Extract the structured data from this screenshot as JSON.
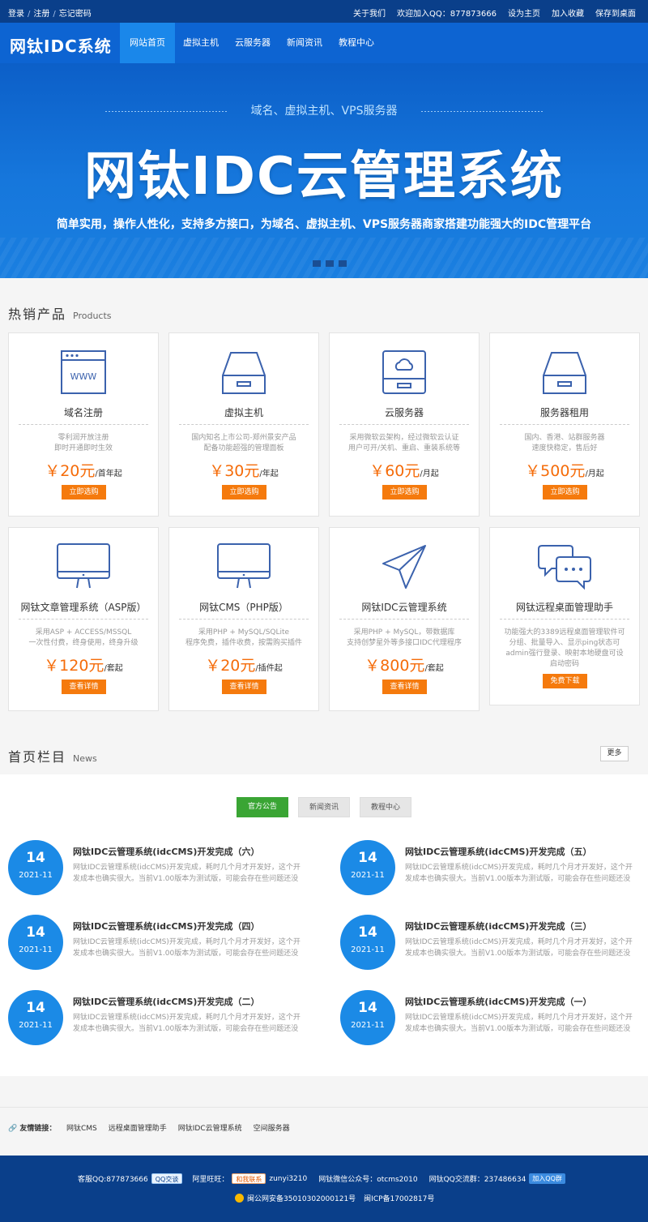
{
  "topbar": {
    "left_links": [
      "登录",
      "注册",
      "忘记密码"
    ],
    "right_links": [
      "关于我们",
      "欢迎加入QQ：877873666",
      "设为主页",
      "加入收藏",
      "保存到桌面"
    ]
  },
  "nav": {
    "logo": "网钛IDC系统",
    "items": [
      "网站首页",
      "虚拟主机",
      "云服务器",
      "新闻资讯",
      "教程中心"
    ]
  },
  "banner": {
    "subtitle": "域名、虚拟主机、VPS服务器",
    "title": "网钛IDC云管理系统",
    "desc": "简单实用，操作人性化，支持多方接口，为域名、虚拟主机、VPS服务器商家搭建功能强大的IDC管理平台"
  },
  "products": {
    "title": "热销产品",
    "title_en": "Products",
    "items": [
      {
        "name": "域名注册",
        "d1": "零利润开放注册",
        "d2": "即时开通即时生效",
        "price": "￥20元",
        "unit": "/首年起",
        "btn": "立即选购",
        "icon": "browser-www-icon"
      },
      {
        "name": "虚拟主机",
        "d1": "国内知名上市公司-郑州景安产品",
        "d2": "配备功能超强的管理面板",
        "price": "￥30元",
        "unit": "/年起",
        "btn": "立即选购",
        "icon": "drive-icon"
      },
      {
        "name": "云服务器",
        "d1": "采用微软云架构，经过微软云认证",
        "d2": "用户可开/关机、重启、重装系统等",
        "price": "￥60元",
        "unit": "/月起",
        "btn": "立即选购",
        "icon": "cloud-server-icon"
      },
      {
        "name": "服务器租用",
        "d1": "国内、香港、站群服务器",
        "d2": "速度快稳定，售后好",
        "price": "￥500元",
        "unit": "/月起",
        "btn": "立即选购",
        "icon": "server-icon"
      },
      {
        "name": "网钛文章管理系统（ASP版）",
        "d1": "采用ASP + ACCESS/MSSQL",
        "d2": "一次性付费，终身使用，终身升级",
        "price": "￥120元",
        "unit": "/套起",
        "btn": "查看详情",
        "icon": "monitor-icon"
      },
      {
        "name": "网钛CMS（PHP版）",
        "d1": "采用PHP + MySQL/SQLite",
        "d2": "程序免费，插件收费，按需购买插件",
        "price": "￥20元",
        "unit": "/插件起",
        "btn": "查看详情",
        "icon": "monitor-icon"
      },
      {
        "name": "网钛IDC云管理系统",
        "d1": "采用PHP + MySQL，带数据库",
        "d2": "支持创梦星外等多接口IDC代理程序",
        "price": "￥800元",
        "unit": "/套起",
        "btn": "查看详情",
        "icon": "paper-plane-icon"
      },
      {
        "name": "网钛远程桌面管理助手",
        "d1": "功能强大的3389远程桌面管理软件可",
        "d2": "分组、批量导入、显示ping状态可",
        "d3": "admin强行登录、映射本地硬盘可设",
        "d4": "启动密码",
        "btn": "免费下载",
        "icon": "chat-icon"
      }
    ]
  },
  "news": {
    "title": "首页栏目",
    "title_en": "News",
    "more": "更多",
    "tabs": [
      "官方公告",
      "新闻资讯",
      "教程中心"
    ],
    "items": [
      {
        "day": "14",
        "ym": "2021-11",
        "title": "网钛IDC云管理系统(idcCMS)开发完成（六）",
        "d1": "网钛IDC云管理系统(idcCMS)开发完成，耗时几个月才开发好，这个开",
        "d2": "发成本也确实很大。当前V1.00版本为测试版，可能会存在些问题还没"
      },
      {
        "day": "14",
        "ym": "2021-11",
        "title": "网钛IDC云管理系统(idcCMS)开发完成（五）",
        "d1": "网钛IDC云管理系统(idcCMS)开发完成，耗时几个月才开发好，这个开",
        "d2": "发成本也确实很大。当前V1.00版本为测试版，可能会存在些问题还没"
      },
      {
        "day": "14",
        "ym": "2021-11",
        "title": "网钛IDC云管理系统(idcCMS)开发完成（四）",
        "d1": "网钛IDC云管理系统(idcCMS)开发完成，耗时几个月才开发好，这个开",
        "d2": "发成本也确实很大。当前V1.00版本为测试版，可能会存在些问题还没"
      },
      {
        "day": "14",
        "ym": "2021-11",
        "title": "网钛IDC云管理系统(idcCMS)开发完成（三）",
        "d1": "网钛IDC云管理系统(idcCMS)开发完成，耗时几个月才开发好，这个开",
        "d2": "发成本也确实很大。当前V1.00版本为测试版，可能会存在些问题还没"
      },
      {
        "day": "14",
        "ym": "2021-11",
        "title": "网钛IDC云管理系统(idcCMS)开发完成（二）",
        "d1": "网钛IDC云管理系统(idcCMS)开发完成，耗时几个月才开发好，这个开",
        "d2": "发成本也确实很大。当前V1.00版本为测试版，可能会存在些问题还没"
      },
      {
        "day": "14",
        "ym": "2021-11",
        "title": "网钛IDC云管理系统(idcCMS)开发完成（一）",
        "d1": "网钛IDC云管理系统(idcCMS)开发完成，耗时几个月才开发好，这个开",
        "d2": "发成本也确实很大。当前V1.00版本为测试版，可能会存在些问题还没"
      }
    ]
  },
  "links": {
    "label": "友情链接：",
    "items": [
      "网钛CMS",
      "远程桌面管理助手",
      "网钛IDC云管理系统",
      "空间服务器"
    ]
  },
  "footer": {
    "kefu_qq": "客服QQ:877873666",
    "qq_badge": "QQ交谈",
    "wangwang_label": "阿里旺旺：",
    "wangwang_badge": "和我联系",
    "wangwang_id": "zunyi3210",
    "wechat": "网钛微信公众号：otcms2010",
    "qq_group": "网钛QQ交流群：237486634",
    "qq_group_badge": "加入QQ群",
    "police": "闽公网安备35010302000121号",
    "icp": "闽ICP备17002817号"
  },
  "colors": {
    "topbar": "#0a3f8a",
    "nav": "#0d64d2",
    "accent_orange": "#f57a0d",
    "accent_green": "#3aa534",
    "date_circle": "#1b8ae6"
  }
}
